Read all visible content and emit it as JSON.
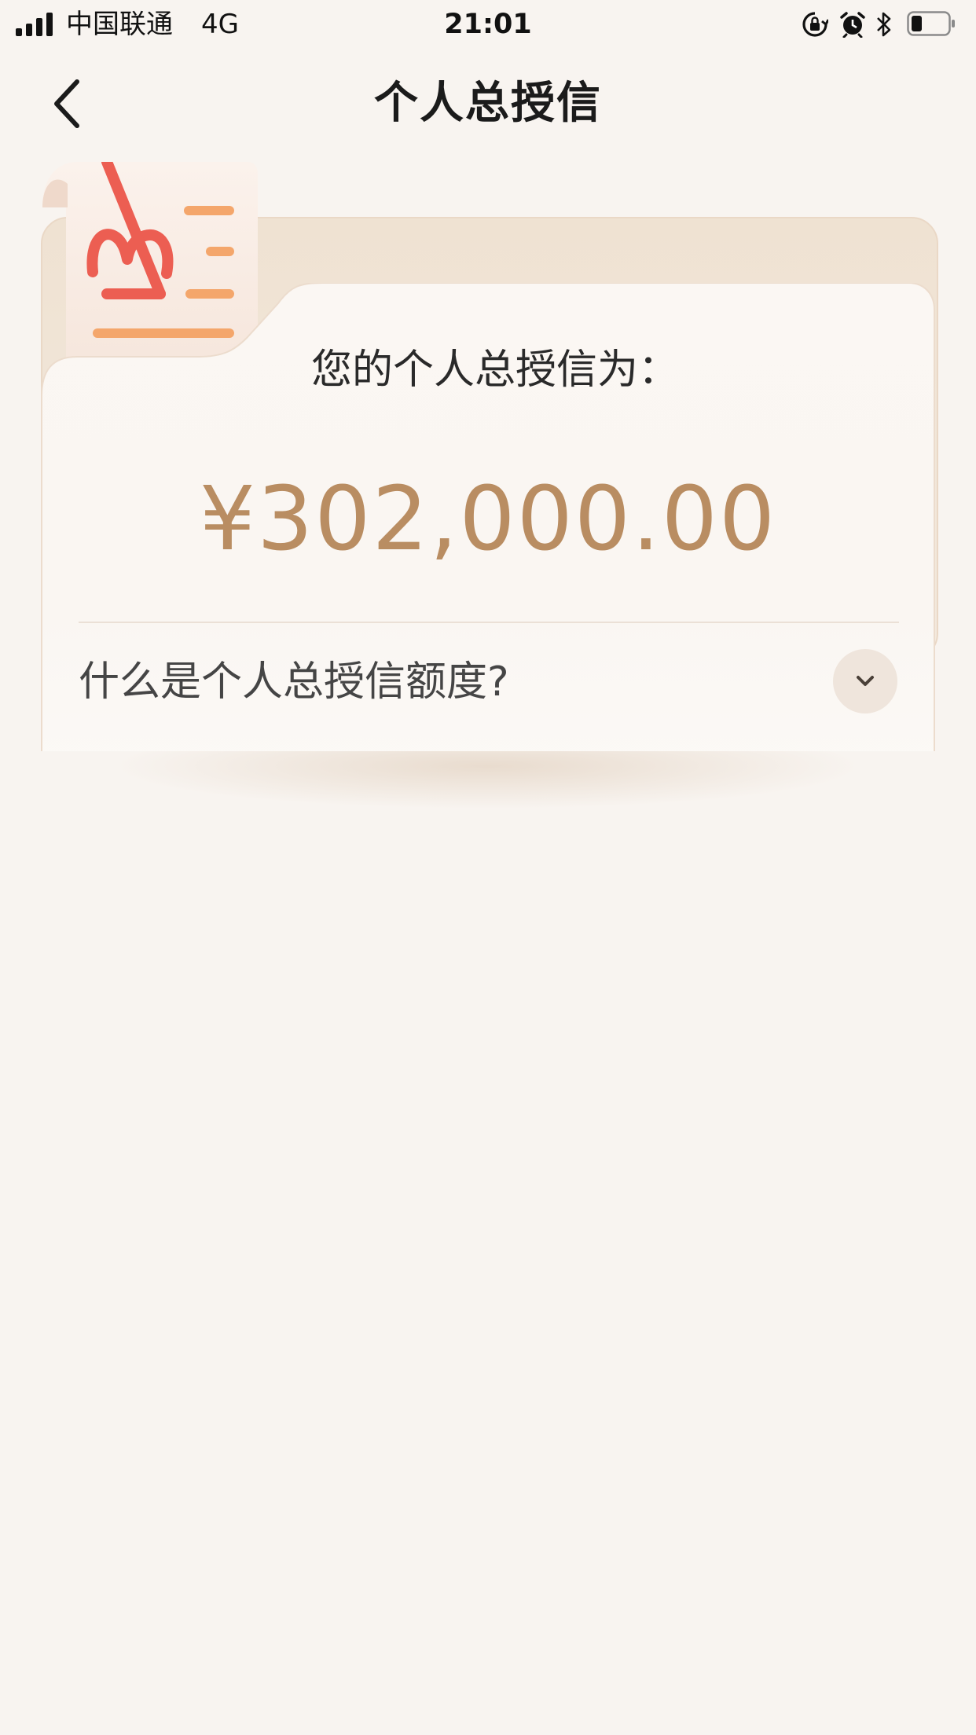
{
  "status_bar": {
    "carrier": "中国联通",
    "network": "4G",
    "time": "21:01",
    "icons": [
      "signal-bars-icon",
      "orientation-lock-icon",
      "alarm-icon",
      "bluetooth-icon",
      "battery-icon"
    ]
  },
  "header": {
    "title": "个人总授信",
    "back_icon": "chevron-left-icon"
  },
  "card": {
    "label": "您的个人总授信为：",
    "amount": "¥302,000.00",
    "faq_question": "什么是个人总授信额度?",
    "expand_icon": "chevron-down-icon"
  },
  "colors": {
    "background": "#f8f4f0",
    "amount": "#b98d62",
    "logo_red": "#ec5e52",
    "logo_orange": "#f4a66b"
  }
}
